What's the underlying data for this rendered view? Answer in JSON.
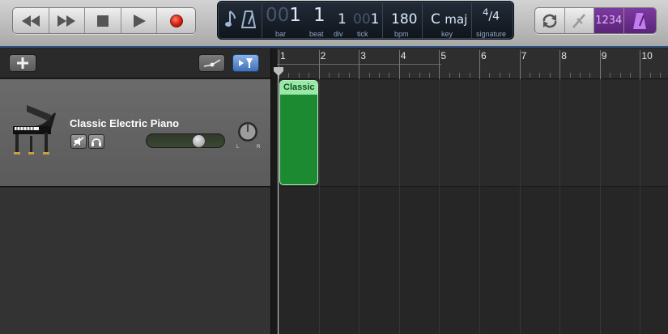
{
  "transport": {
    "buttons": [
      {
        "name": "rewind",
        "icon": "rewind-icon"
      },
      {
        "name": "fast-forward",
        "icon": "fast-forward-icon"
      },
      {
        "name": "stop",
        "icon": "stop-icon"
      },
      {
        "name": "play",
        "icon": "play-icon"
      },
      {
        "name": "record",
        "icon": "record-icon",
        "color": "#d51d0e"
      }
    ]
  },
  "lcd": {
    "bar_dim": "00",
    "bar": "1",
    "bar_label": "bar",
    "beat": "1",
    "beat_label": "beat",
    "div": "1",
    "div_label": "div",
    "tick_dim": "00",
    "tick": "1",
    "tick_label": "tick",
    "bpm": "180",
    "bpm_label": "bpm",
    "key_root": "C",
    "key_mode": "maj",
    "key_label": "key",
    "sig_top": "4",
    "sig_bottom": "4",
    "sig_label": "signature"
  },
  "tools": {
    "count_in": "1234",
    "accent": "#7d3aa0",
    "metronome_color": "#c27cf0"
  },
  "track": {
    "name": "Classic Electric Piano",
    "pan_left": "L",
    "pan_right": "R",
    "volume": 0.68
  },
  "ruler": {
    "bars": [
      "1",
      "2",
      "3",
      "4",
      "5",
      "6",
      "7",
      "8",
      "9",
      "10"
    ]
  },
  "region": {
    "title": "Classic",
    "color": "#1c8a31"
  }
}
